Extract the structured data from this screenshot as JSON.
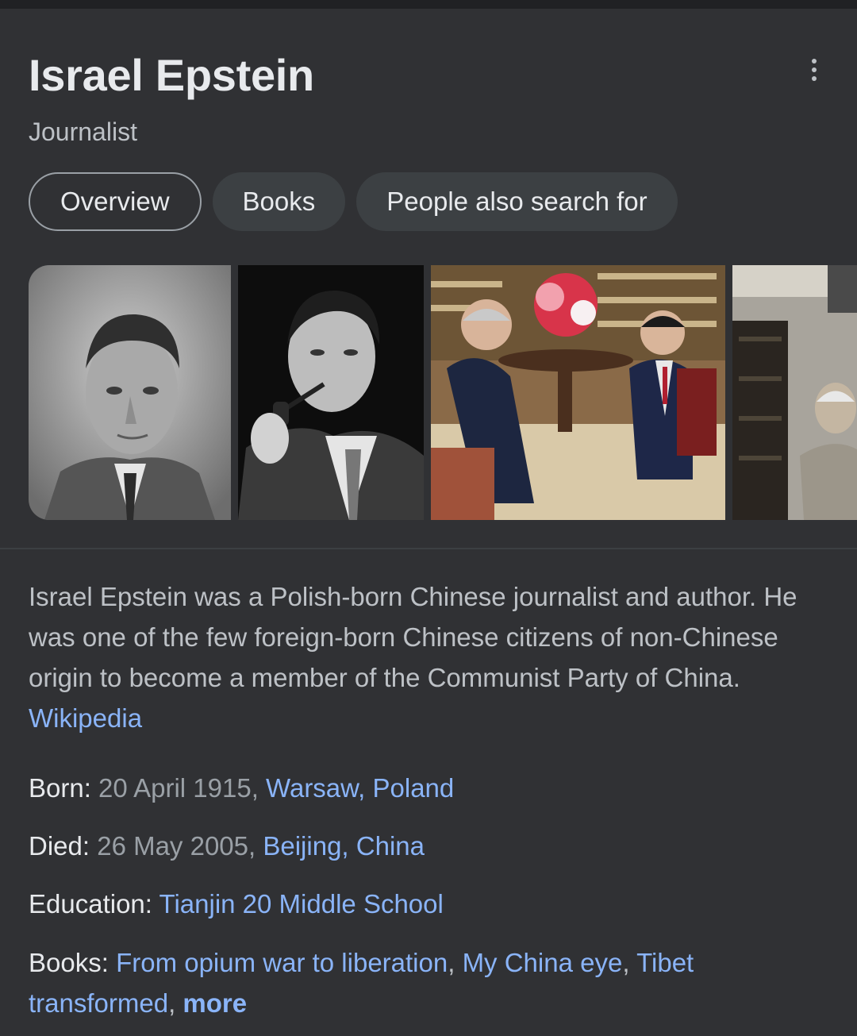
{
  "header": {
    "title": "Israel Epstein",
    "subtitle": "Journalist",
    "menu_icon": "more-vert-icon"
  },
  "tabs": [
    {
      "label": "Overview",
      "active": true
    },
    {
      "label": "Books",
      "active": false
    },
    {
      "label": "People also search for",
      "active": false
    }
  ],
  "images": [
    {
      "subject": "black-and-white portrait of a man"
    },
    {
      "subject": "black-and-white photo of a man with a pipe"
    },
    {
      "subject": "color photo of two men seated in a room with flowers"
    },
    {
      "subject": "photo of an elderly man in a room"
    }
  ],
  "description": {
    "text": "Israel Epstein was a Polish-born Chinese journalist and author. He was one of the few foreign-born Chinese citizens of non-Chinese origin to become a member of the Communist Party of China.",
    "source_link": "Wikipedia"
  },
  "facts": {
    "born": {
      "label": "Born:",
      "date": "20 April 1915,",
      "place": "Warsaw, Poland"
    },
    "died": {
      "label": "Died:",
      "date": "26 May 2005,",
      "place": "Beijing, China"
    },
    "education": {
      "label": "Education:",
      "value": "Tianjin 20 Middle School"
    },
    "books": {
      "label": "Books:",
      "items": [
        "From opium war to liberation",
        "My China eye",
        "Tibet transformed"
      ],
      "more": "more"
    }
  },
  "colors": {
    "background": "#303134",
    "link": "#8ab4f8",
    "text": "#e8eaed",
    "muted": "#bdc1c6"
  }
}
